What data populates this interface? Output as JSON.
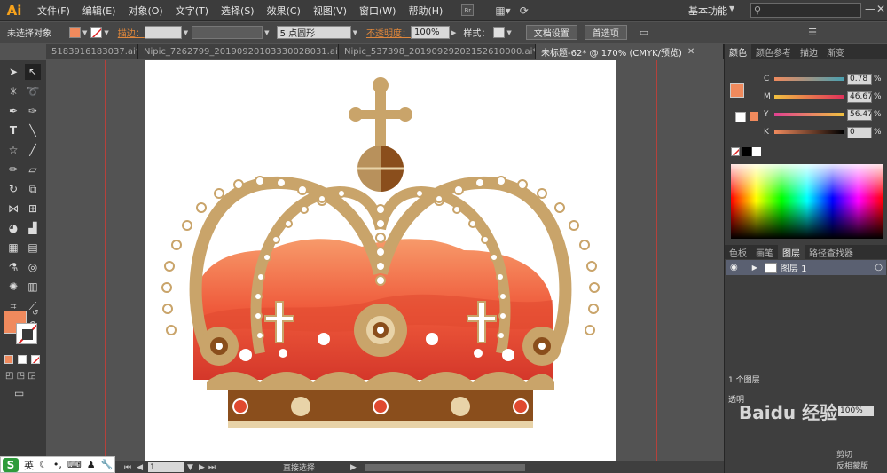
{
  "menubar": {
    "logo": "Ai",
    "items": [
      "文件(F)",
      "编辑(E)",
      "对象(O)",
      "文字(T)",
      "选择(S)",
      "效果(C)",
      "视图(V)",
      "窗口(W)",
      "帮助(H)"
    ],
    "br_label": "Br",
    "workspace": "基本功能",
    "minimize": "—",
    "close": "✕"
  },
  "control": {
    "selection": "未选择对象",
    "stroke_label": "描边：",
    "brush_label": "5 点圆形",
    "opacity_label": "不透明度：",
    "opacity_value": "100%",
    "style_label": "样式：",
    "doc_settings": "文档设置",
    "preferences": "首选项",
    "fill_color": "#f08a5d"
  },
  "tabs": [
    {
      "label": "5183916183037.ai*"
    },
    {
      "label": "Nipic_7262799_20190920103330028031.ai*"
    },
    {
      "label": "Nipic_537398_20190929202152610000.ai*"
    },
    {
      "label": "未标题-62* @ 170% (CMYK/预览)",
      "active": true
    }
  ],
  "color_panel": {
    "tabs": [
      "颜色",
      "颜色参考",
      "描边",
      "渐变"
    ],
    "c": "0.78",
    "m": "46.67",
    "y": "56.47",
    "k": "0",
    "c_label": "C",
    "m_label": "M",
    "y_label": "Y",
    "k_label": "K",
    "pct": "%"
  },
  "layers_panel": {
    "tabs": [
      "色板",
      "画笔",
      "图层",
      "路径查找器"
    ],
    "layer_name": "图层 1",
    "count": "1 个图层",
    "transparency_tab": "透明",
    "opacity_value": "100%",
    "clip_label": "剪切",
    "invert_label": "反相蒙版"
  },
  "status": {
    "zoom": "170%",
    "page": "1",
    "tool_name": "直接选择"
  },
  "taskbar": {
    "ime": "英"
  },
  "watermark": "Baidu 经验",
  "colors": {
    "crown_gold": "#c9a46a",
    "crown_red": "#e0492f",
    "crown_orange": "#f58a5c",
    "crown_brown": "#8a4e1c",
    "pearl": "#ffffff",
    "guide": "#b5413b"
  }
}
